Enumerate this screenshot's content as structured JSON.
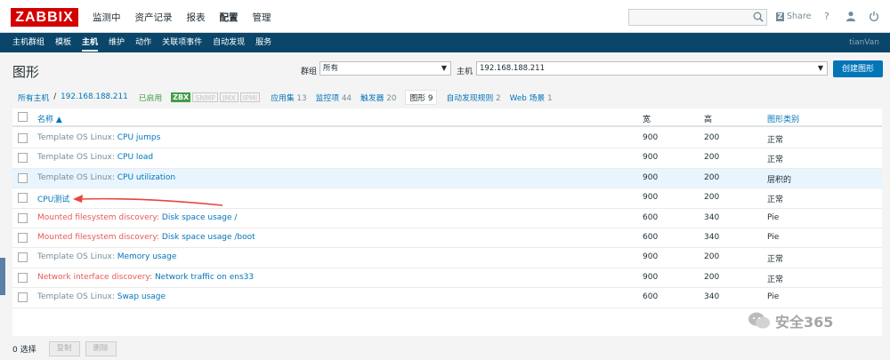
{
  "logo": "ZABBIX",
  "main_nav": [
    {
      "label": "监测中",
      "active": false
    },
    {
      "label": "资产记录",
      "active": false
    },
    {
      "label": "报表",
      "active": false
    },
    {
      "label": "配置",
      "active": true
    },
    {
      "label": "管理",
      "active": false
    }
  ],
  "topbar": {
    "share_label": "Share",
    "help_label": "?"
  },
  "sub_nav": [
    {
      "label": "主机群组",
      "active": false
    },
    {
      "label": "模板",
      "active": false
    },
    {
      "label": "主机",
      "active": true
    },
    {
      "label": "维护",
      "active": false
    },
    {
      "label": "动作",
      "active": false
    },
    {
      "label": "关联项事件",
      "active": false
    },
    {
      "label": "自动发现",
      "active": false
    },
    {
      "label": "服务",
      "active": false
    }
  ],
  "username": "tianVan",
  "page": {
    "title": "图形",
    "group_label": "群组",
    "group_value": "所有",
    "host_label": "主机",
    "host_value": "192.168.188.211",
    "create_button": "创建图形"
  },
  "host_nav": {
    "all_hosts": "所有主机",
    "separator": "/",
    "host": "192.168.188.211",
    "status": "已启用",
    "badges": {
      "zbx": "ZBX",
      "snmp": "SNMP",
      "jmx": "JMX",
      "ipmi": "IPMI"
    },
    "tabs": [
      {
        "label": "应用集",
        "count": "13",
        "active": false
      },
      {
        "label": "监控项",
        "count": "44",
        "active": false
      },
      {
        "label": "触发器",
        "count": "20",
        "active": false
      },
      {
        "label": "图形",
        "count": "9",
        "active": true
      },
      {
        "label": "自动发现规则",
        "count": "2",
        "active": false
      },
      {
        "label": "Web 场景",
        "count": "1",
        "active": false
      }
    ]
  },
  "table": {
    "columns": {
      "name": "名称 ▲",
      "width": "宽",
      "height": "高",
      "type": "图形类别"
    },
    "rows": [
      {
        "prefix": "Template OS Linux: ",
        "prefix_color": "gray",
        "name": "CPU jumps",
        "width": "900",
        "height": "200",
        "type": "正常"
      },
      {
        "prefix": "Template OS Linux: ",
        "prefix_color": "gray",
        "name": "CPU load",
        "width": "900",
        "height": "200",
        "type": "正常"
      },
      {
        "prefix": "Template OS Linux: ",
        "prefix_color": "gray",
        "name": "CPU utilization",
        "width": "900",
        "height": "200",
        "type": "层积的"
      },
      {
        "prefix": "",
        "prefix_color": "gray",
        "name": "CPU测试",
        "width": "900",
        "height": "200",
        "type": "正常"
      },
      {
        "prefix": "Mounted filesystem discovery: ",
        "prefix_color": "red",
        "name": "Disk space usage /",
        "width": "600",
        "height": "340",
        "type": "Pie"
      },
      {
        "prefix": "Mounted filesystem discovery: ",
        "prefix_color": "red",
        "name": "Disk space usage /boot",
        "width": "600",
        "height": "340",
        "type": "Pie"
      },
      {
        "prefix": "Template OS Linux: ",
        "prefix_color": "gray",
        "name": "Memory usage",
        "width": "900",
        "height": "200",
        "type": "正常"
      },
      {
        "prefix": "Network interface discovery: ",
        "prefix_color": "red",
        "name": "Network traffic on ens33",
        "width": "900",
        "height": "200",
        "type": "正常"
      },
      {
        "prefix": "Template OS Linux: ",
        "prefix_color": "gray",
        "name": "Swap usage",
        "width": "600",
        "height": "340",
        "type": "Pie"
      }
    ]
  },
  "footer": {
    "selected": "0 选择",
    "copy": "复制",
    "delete": "删除"
  },
  "watermark": "安全365",
  "colors": {
    "brand_red": "#d40000",
    "nav_blue": "#0a466a",
    "link_blue": "#0275b8",
    "enabled_green": "#429e47",
    "discovery_red": "#e45959",
    "arrow_red": "#e8463b"
  }
}
